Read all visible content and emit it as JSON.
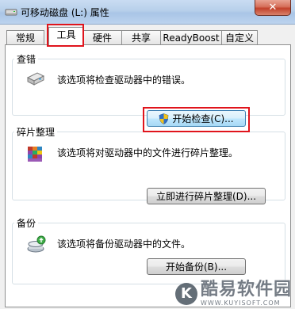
{
  "window": {
    "title": "可移动磁盘 (L:) 属性",
    "close_glyph": "✕"
  },
  "tabs": [
    {
      "label": "常规"
    },
    {
      "label": "工具"
    },
    {
      "label": "硬件"
    },
    {
      "label": "共享"
    },
    {
      "label": "ReadyBoost"
    },
    {
      "label": "自定义"
    }
  ],
  "active_tab": "工具",
  "groups": {
    "error_check": {
      "title": "查错",
      "description": "该选项将检查驱动器中的错误。",
      "button": "开始检查(C)...",
      "icon": "drive-check-icon"
    },
    "defrag": {
      "title": "碎片整理",
      "description": "该选项将对驱动器中的文件进行碎片整理。",
      "button": "立即进行碎片整理(D)...",
      "icon": "defrag-icon"
    },
    "backup": {
      "title": "备份",
      "description": "该选项将备份驱动器中的文件。",
      "button": "开始备份(B)...",
      "icon": "backup-icon"
    }
  },
  "watermark": {
    "logo_letter": "K",
    "text": "酷易软件园",
    "url": "WWW.KUYISOFT.COM"
  },
  "colors": {
    "highlight": "#e0141c",
    "shield_blue": "#2f6fc7",
    "shield_yellow": "#f2c21b"
  }
}
